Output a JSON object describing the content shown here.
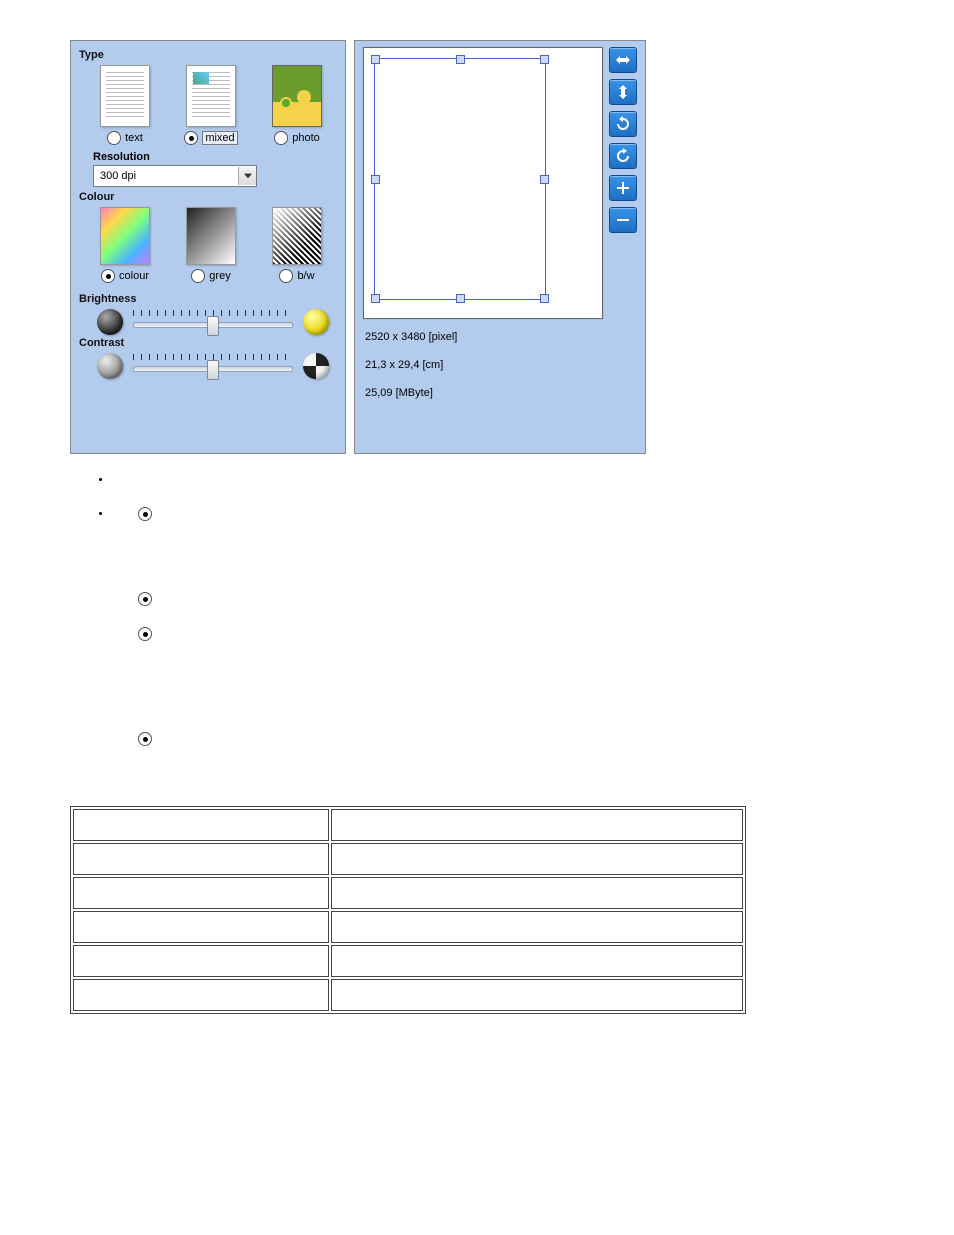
{
  "type_panel": {
    "title": "Type",
    "options": [
      {
        "label": "text",
        "checked": false
      },
      {
        "label": "mixed",
        "checked": true
      },
      {
        "label": "photo",
        "checked": false
      }
    ],
    "resolution_title": "Resolution",
    "resolution_value": "300 dpi"
  },
  "colour_panel": {
    "title": "Colour",
    "options": [
      {
        "label": "colour",
        "checked": true
      },
      {
        "label": "grey",
        "checked": false
      },
      {
        "label": "b/w",
        "checked": false
      }
    ]
  },
  "brightness_title": "Brightness",
  "contrast_title": "Contrast",
  "preview": {
    "pixel": "2520 x 3480 [pixel]",
    "cm": "21,3 x 29,4 [cm]",
    "mbyte": "25,09 [MByte]"
  },
  "toolbar_icons": [
    "flip-horizontal",
    "flip-vertical",
    "rotate-right",
    "rotate-left",
    "zoom-in",
    "zoom-out"
  ]
}
